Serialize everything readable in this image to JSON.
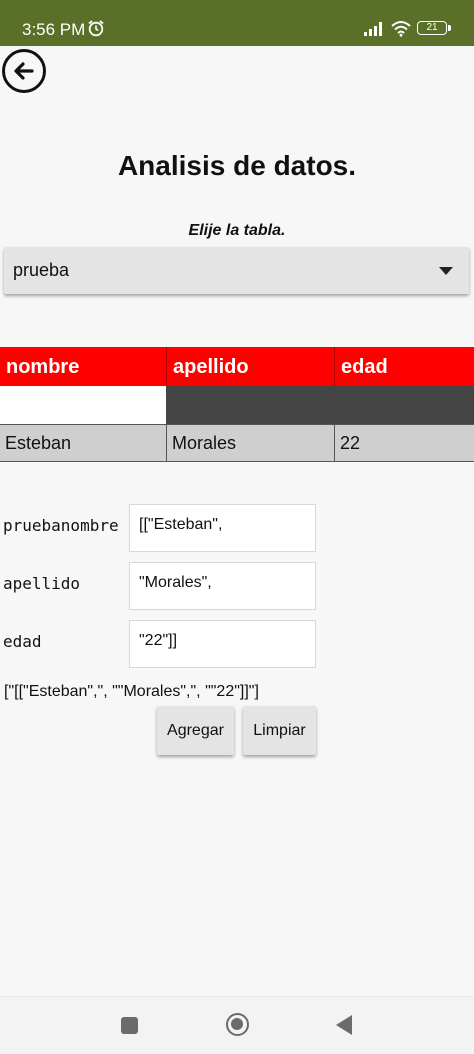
{
  "status_bar": {
    "time": "3:56 PM",
    "battery": "21",
    "icons": [
      "alarm-icon",
      "signal-icon",
      "wifi-icon",
      "battery-icon"
    ],
    "background": "#5a7028"
  },
  "header": {
    "back_icon": "arrow-left-icon",
    "title": "Analisis de datos.",
    "subtitle": "Elije la tabla."
  },
  "table_selector": {
    "selected": "prueba",
    "arrow_icon": "caret-down-icon"
  },
  "data_table": {
    "header_color": "#ff0000",
    "columns": [
      "nombre",
      "apellido",
      "edad"
    ],
    "rows": [
      [
        "Esteban",
        "Morales",
        "22"
      ]
    ]
  },
  "form": {
    "fields": [
      {
        "label": "pruebanombre",
        "value": "[[\"Esteban\","
      },
      {
        "label": "apellido",
        "value": "\"Morales\","
      },
      {
        "label": "edad",
        "value": "\"22\"]]"
      }
    ],
    "result_text": "[\"[[\"Esteban\",\", \"\"Morales\",\", \"\"22\"]]\"]",
    "add_label": "Agregar",
    "clear_label": "Limpiar"
  },
  "nav_bar": {
    "icons": [
      "recents-icon",
      "home-icon",
      "back-triangle-icon"
    ]
  }
}
